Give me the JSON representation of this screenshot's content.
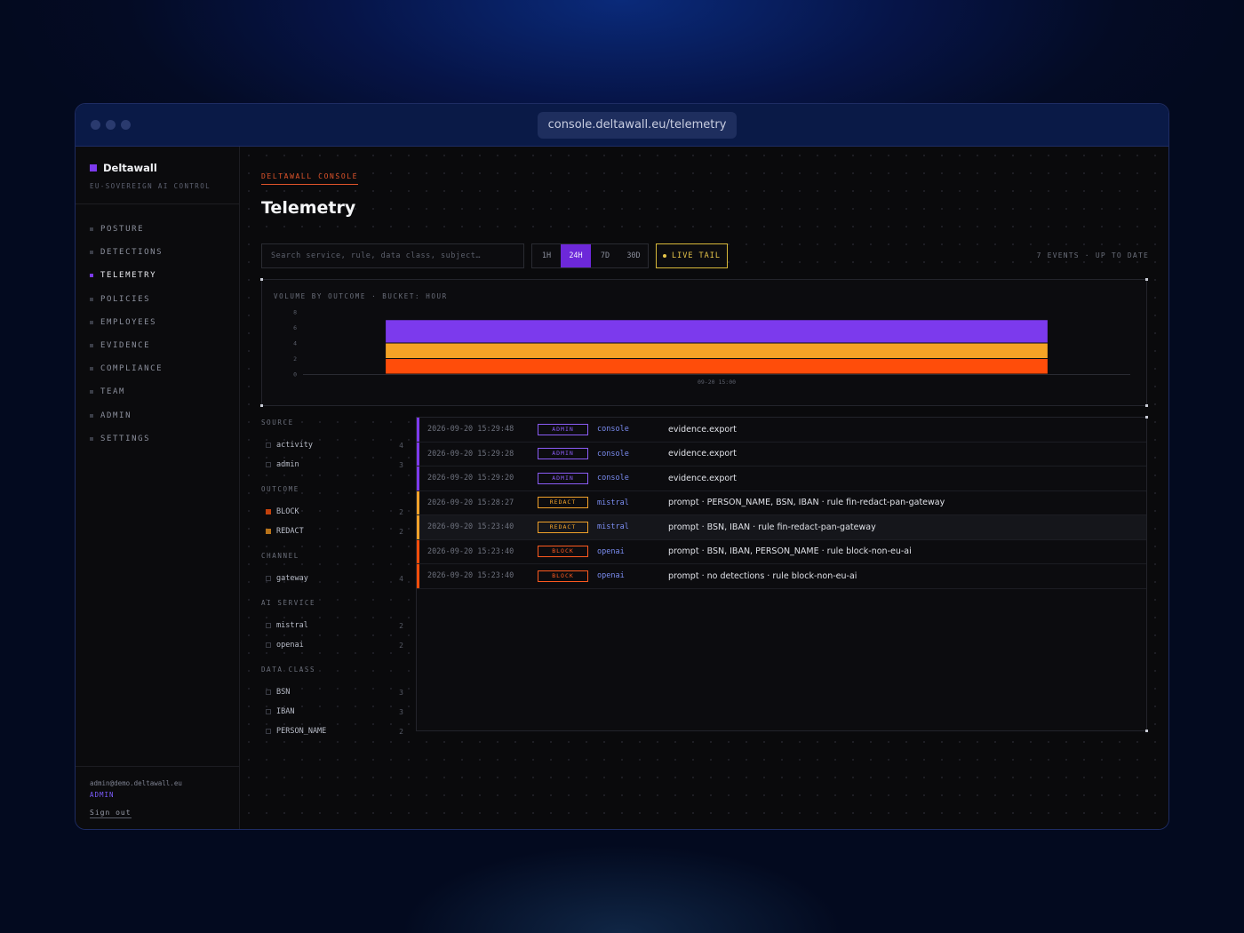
{
  "browser": {
    "url": "console.deltawall.eu/telemetry"
  },
  "sidebar": {
    "brand": "Deltawall",
    "tagline": "EU-SOVEREIGN AI CONTROL",
    "nav": [
      {
        "label": "POSTURE",
        "active": false
      },
      {
        "label": "DETECTIONS",
        "active": false
      },
      {
        "label": "TELEMETRY",
        "active": true
      },
      {
        "label": "POLICIES",
        "active": false
      },
      {
        "label": "EMPLOYEES",
        "active": false
      },
      {
        "label": "EVIDENCE",
        "active": false
      },
      {
        "label": "COMPLIANCE",
        "active": false
      },
      {
        "label": "TEAM",
        "active": false
      },
      {
        "label": "ADMIN",
        "active": false
      },
      {
        "label": "SETTINGS",
        "active": false
      }
    ],
    "user": {
      "email": "admin@demo.deltawall.eu",
      "role": "ADMIN",
      "signout": "Sign out"
    }
  },
  "main": {
    "eyebrow": "DELTAWALL CONSOLE",
    "title": "Telemetry",
    "search": {
      "placeholder": "Search service, rule, data class, subject…",
      "value": ""
    },
    "ranges": [
      {
        "label": "1H",
        "active": false
      },
      {
        "label": "24H",
        "active": true
      },
      {
        "label": "7D",
        "active": false
      },
      {
        "label": "30D",
        "active": false
      }
    ],
    "live_tail": "LIVE TAIL",
    "status": "7 EVENTS · UP TO DATE"
  },
  "chart_data": {
    "type": "bar",
    "title": "VOLUME BY OUTCOME · BUCKET: HOUR",
    "categories": [
      "09-20 15:00"
    ],
    "stacked": true,
    "series": [
      {
        "name": "BLOCK",
        "values": [
          2
        ],
        "color": "#ff4d0a"
      },
      {
        "name": "REDACT",
        "values": [
          2
        ],
        "color": "#f5a326"
      },
      {
        "name": "ADMIN",
        "values": [
          3
        ],
        "color": "#7c3aed"
      }
    ],
    "yticks": [
      0,
      2,
      4,
      6,
      8
    ],
    "ylim": [
      0,
      8
    ]
  },
  "filters": [
    {
      "title": "SOURCE",
      "items": [
        {
          "label": "activity",
          "count": "4",
          "swatch": ""
        },
        {
          "label": "admin",
          "count": "3",
          "swatch": ""
        }
      ]
    },
    {
      "title": "OUTCOME",
      "items": [
        {
          "label": "BLOCK",
          "count": "2",
          "swatch": "block"
        },
        {
          "label": "REDACT",
          "count": "2",
          "swatch": "redact"
        }
      ]
    },
    {
      "title": "CHANNEL",
      "items": [
        {
          "label": "gateway",
          "count": "4",
          "swatch": ""
        }
      ]
    },
    {
      "title": "AI SERVICE",
      "items": [
        {
          "label": "mistral",
          "count": "2",
          "swatch": ""
        },
        {
          "label": "openai",
          "count": "2",
          "swatch": ""
        }
      ]
    },
    {
      "title": "DATA CLASS",
      "items": [
        {
          "label": "BSN",
          "count": "3",
          "swatch": ""
        },
        {
          "label": "IBAN",
          "count": "3",
          "swatch": ""
        },
        {
          "label": "PERSON_NAME",
          "count": "2",
          "swatch": ""
        }
      ]
    }
  ],
  "events": [
    {
      "ts": "2026-09-20 15:29:48",
      "badge": "ADMIN",
      "kind": "admin",
      "source": "console",
      "detail": "evidence.export",
      "highlight": false
    },
    {
      "ts": "2026-09-20 15:29:28",
      "badge": "ADMIN",
      "kind": "admin",
      "source": "console",
      "detail": "evidence.export",
      "highlight": false
    },
    {
      "ts": "2026-09-20 15:29:20",
      "badge": "ADMIN",
      "kind": "admin",
      "source": "console",
      "detail": "evidence.export",
      "highlight": false
    },
    {
      "ts": "2026-09-20 15:28:27",
      "badge": "REDACT",
      "kind": "redact",
      "source": "mistral",
      "detail": "prompt · PERSON_NAME, BSN, IBAN · rule fin-redact-pan-gateway",
      "highlight": false
    },
    {
      "ts": "2026-09-20 15:23:40",
      "badge": "REDACT",
      "kind": "redact",
      "source": "mistral",
      "detail": "prompt · BSN, IBAN · rule fin-redact-pan-gateway",
      "highlight": true
    },
    {
      "ts": "2026-09-20 15:23:40",
      "badge": "BLOCK",
      "kind": "block",
      "source": "openai",
      "detail": "prompt · BSN, IBAN, PERSON_NAME · rule block-non-eu-ai",
      "highlight": false
    },
    {
      "ts": "2026-09-20 15:23:40",
      "badge": "BLOCK",
      "kind": "block",
      "source": "openai",
      "detail": "prompt · no detections · rule block-non-eu-ai",
      "highlight": false
    }
  ],
  "colors": {
    "admin": "#7c3aed",
    "redact": "#f0a12a",
    "block": "#ff4d0a",
    "admin_badge": "#8b5cf6",
    "redact_badge": "#f0a12a",
    "block_badge": "#ff5a1f"
  }
}
